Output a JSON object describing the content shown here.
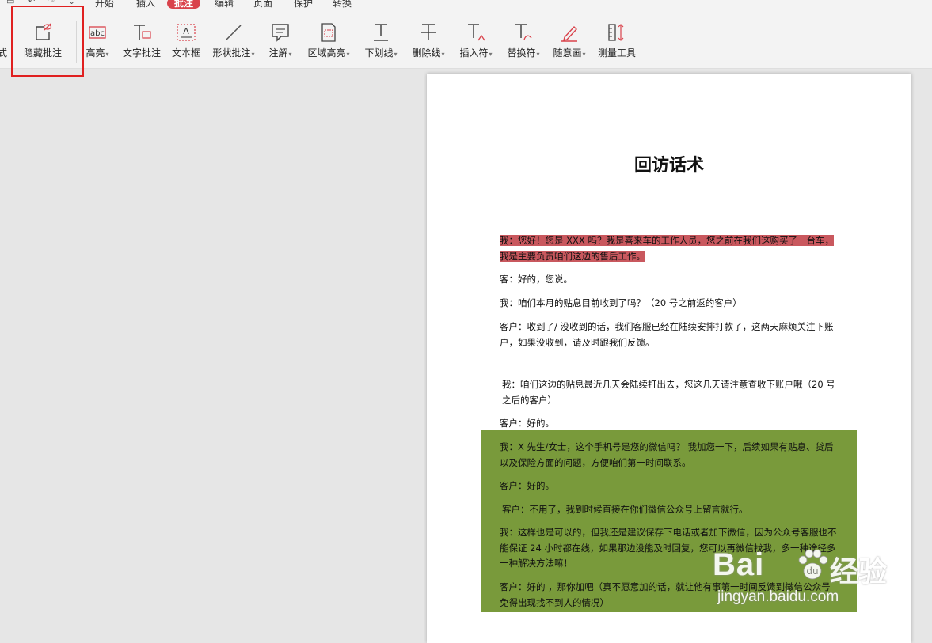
{
  "menu": {
    "items": [
      "开始",
      "插入",
      "批注",
      "编辑",
      "页面",
      "保护",
      "转换"
    ],
    "active": "批注"
  },
  "toolbar": {
    "partial_left": "式",
    "tools": [
      {
        "label": "隐藏批注",
        "icon": "hide-comment-icon",
        "dropdown": false
      },
      {
        "label": "高亮",
        "icon": "highlight-icon",
        "dropdown": true
      },
      {
        "label": "文字批注",
        "icon": "text-comment-icon",
        "dropdown": false
      },
      {
        "label": "文本框",
        "icon": "textbox-icon",
        "dropdown": false
      },
      {
        "label": "形状批注",
        "icon": "shape-comment-icon",
        "dropdown": true
      },
      {
        "label": "注解",
        "icon": "note-icon",
        "dropdown": true
      },
      {
        "label": "区域高亮",
        "icon": "area-highlight-icon",
        "dropdown": true
      },
      {
        "label": "下划线",
        "icon": "underline-icon",
        "dropdown": true
      },
      {
        "label": "删除线",
        "icon": "strikethrough-icon",
        "dropdown": true
      },
      {
        "label": "插入符",
        "icon": "insert-caret-icon",
        "dropdown": true
      },
      {
        "label": "替换符",
        "icon": "replace-icon",
        "dropdown": true
      },
      {
        "label": "随意画",
        "icon": "freehand-pen-icon",
        "dropdown": true
      },
      {
        "label": "测量工具",
        "icon": "measure-icon",
        "dropdown": false
      }
    ],
    "highlight_color": "#e02020"
  },
  "document": {
    "title": "回访话术",
    "paragraphs": [
      "我：您好！您是 XXX 吗？我是喜来车的工作人员，您之前在我们这购买了一台车，我是主要负责咱们这边的售后工作。",
      "客：好的，您说。",
      "我：咱们本月的贴息目前收到了吗？（20 号之前返的客户）",
      "客户：收到了/ 没收到的话，我们客服已经在陆续安排打款了，这两天麻烦关注下账户，如果没收到，请及时跟我们反馈。",
      "我：咱们这边的贴息最近几天会陆续打出去，您这几天请注意查收下账户哦（20 号之后的客户）",
      "客户：好的。",
      "我：X 先生/女士，这个手机号是您的微信吗？ 我加您一下，后续如果有贴息、贷后以及保险方面的问题，方便咱们第一时间联系。",
      "客户：好的。",
      "客户：不用了，我到时候直接在你们微信公众号上留言就行。",
      "我：这样也是可以的，但我还是建议保存下电话或者加下微信，因为公众号客服也不能保证 24 小时都在线，如果那边没能及时回复，您可以再微信找我，多一种途径多一种解决方法嘛！",
      "客户：好的 ，那你加吧（真不愿意加的话，就让他有事第一时间反馈到微信公众号免得出现找不到人的情况）"
    ],
    "red_highlight_color": "#c9585e",
    "green_area_color": "#799a3b"
  },
  "watermark": {
    "brand": "Bai",
    "brand_tail": "经验",
    "url": "jingyan.baidu.com"
  }
}
